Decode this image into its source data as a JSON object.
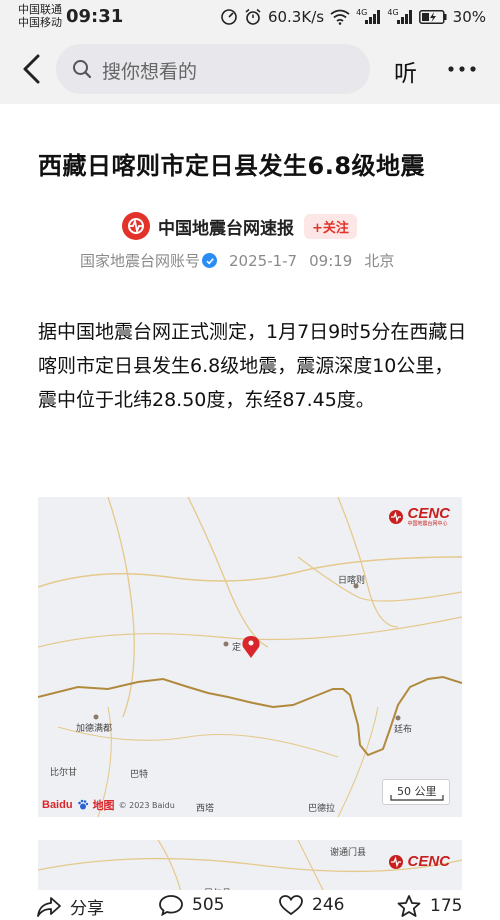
{
  "status_bar": {
    "carrier_1": "中国联通",
    "carrier_2": "中国移动",
    "time": "09:31",
    "net_speed": "60.3K/s",
    "signal_tag_1": "4G",
    "signal_tag_2": "4G",
    "battery": "30%"
  },
  "top_bar": {
    "search_placeholder": "搜你想看的",
    "listen_label": "听",
    "icons": [
      "back-arrow-icon",
      "search-icon",
      "more-icon"
    ]
  },
  "article": {
    "title": "西藏日喀则市定日县发生6.8级地震",
    "source_name": "中国地震台网速报",
    "follow_label": "+关注",
    "account_type": "国家地震台网账号",
    "date": "2025-1-7",
    "time": "09:19",
    "location": "北京",
    "body": "据中国地震台网正式测定，1月7日9时5分在西藏日喀则市定日县发生6.8级地震，震源深度10公里，震中位于北纬28.50度，东经87.45度。"
  },
  "map_1": {
    "logo_text": "CENC",
    "logo_subtext": "中国地震台网中心",
    "places": [
      "日喀则",
      "定",
      "加德满都",
      "廷布",
      "比尔甘",
      "巴特",
      "西塔",
      "巴德拉"
    ],
    "scale_label": "50 公里",
    "copyright": "© 2023 Baidu",
    "baidu_label": "Baidu",
    "baidu_cn": "地图"
  },
  "map_2": {
    "logo_text": "CENC",
    "places": [
      "谢通门县",
      "昂仁县"
    ]
  },
  "actions": {
    "share_label": "分享",
    "comments": "505",
    "likes": "246",
    "favorites": "175"
  },
  "colors": {
    "accent_red": "#e3322a",
    "map_border": "#b08a3c",
    "marker": "#d8262b",
    "verified_blue": "#2a8df5"
  }
}
